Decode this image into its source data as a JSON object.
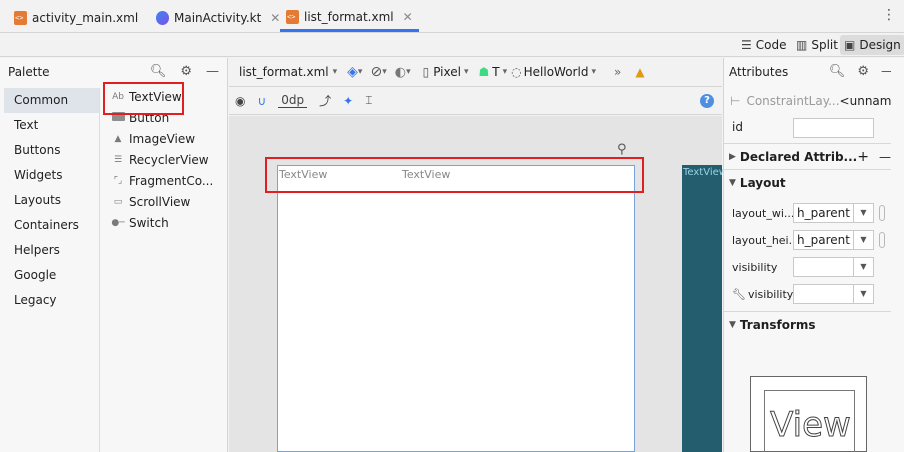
{
  "tabs": [
    {
      "label": "activity_main.xml",
      "icon": "xml-file-icon",
      "active": false
    },
    {
      "label": "MainActivity.kt",
      "icon": "kotlin-file-icon",
      "active": false
    },
    {
      "label": "list_format.xml",
      "icon": "xml-file-icon",
      "active": true
    }
  ],
  "view_modes": {
    "code": "Code",
    "split": "Split",
    "design": "Design",
    "selected": "Design"
  },
  "palette": {
    "title": "Palette",
    "categories": [
      "Common",
      "Text",
      "Buttons",
      "Widgets",
      "Layouts",
      "Containers",
      "Helpers",
      "Google",
      "Legacy"
    ],
    "selected_category": "Common",
    "items": [
      "TextView",
      "Button",
      "ImageView",
      "RecyclerView",
      "FragmentCo...",
      "ScrollView",
      "Switch"
    ],
    "item_icons": {
      "TextView": "Ab"
    }
  },
  "design_toolbar": {
    "file": "list_format.xml",
    "device": "Pixel",
    "api": "T",
    "theme": "HelloWorld",
    "margin": "0dp"
  },
  "canvas": {
    "textview_1": "TextView",
    "textview_2": "TextView",
    "blueprint_label": "TextView"
  },
  "attributes": {
    "title": "Attributes",
    "component": "ConstraintLay...",
    "component_name": "<unnamed>",
    "id_label": "id",
    "declared": "Declared Attrib...",
    "layout_section": "Layout",
    "layout_width_label": "layout_wi...",
    "layout_width_value": "h_parent",
    "layout_height_label": "layout_hei...",
    "layout_height_value": "h_parent",
    "visibility_label": "visibility",
    "tools_visibility_label": "visibility",
    "transforms": "Transforms",
    "preview_label": "View"
  },
  "colors": {
    "accent": "#3574f0",
    "highlight_red": "#e02020",
    "blueprint": "#245d6e"
  }
}
